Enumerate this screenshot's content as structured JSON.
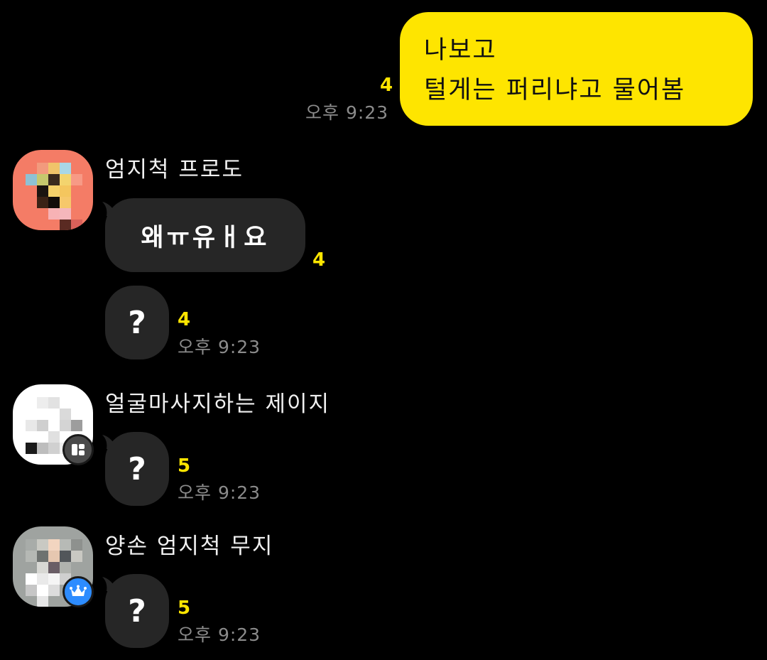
{
  "messages": {
    "outgoing": {
      "lines": [
        "나보고",
        "털게는 퍼리냐고 물어봄"
      ],
      "unread": "4",
      "time": "오후 9:23"
    },
    "group1": {
      "sender": "엄지척 프로도",
      "avatar_icon": "pixelated-profile-avatar",
      "bubbles": [
        {
          "text": "왜ㅠ유ㅐ요",
          "unread": "4"
        },
        {
          "text": "?",
          "unread": "4",
          "time": "오후 9:23"
        }
      ]
    },
    "group2": {
      "sender": "얼굴마사지하는 제이지",
      "avatar_icon": "pixelated-profile-avatar",
      "badge_icon": "manager-badge-icon",
      "bubbles": [
        {
          "text": "?",
          "unread": "5",
          "time": "오후 9:23"
        }
      ]
    },
    "group3": {
      "sender": "양손 엄지척 무지",
      "avatar_icon": "pixelated-profile-avatar",
      "badge_icon": "crown-icon",
      "bubbles": [
        {
          "text": "?",
          "unread": "5",
          "time": "오후 9:23"
        }
      ]
    }
  },
  "colors": {
    "background": "#000000",
    "my_bubble": "#FEE500",
    "other_bubble": "#262626",
    "unread_count": "#FEE500",
    "time_text": "#8b8b8b",
    "crown_badge": "#2D8CFF"
  }
}
